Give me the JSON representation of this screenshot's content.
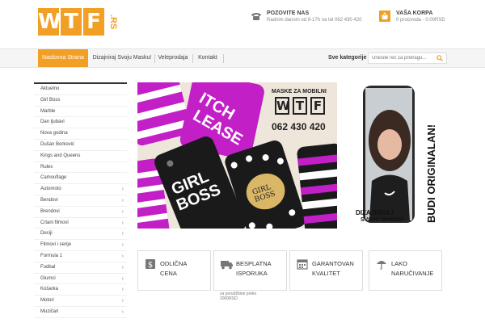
{
  "logo": {
    "letters": [
      "W",
      "T",
      "F"
    ],
    "suffix": ".RS"
  },
  "contact": {
    "title": "POZOVITE NAS",
    "subtitle": "Radnim danom od 9-17h na tel 062 430 420"
  },
  "cart": {
    "title": "VAŠA KORPA",
    "summary": "0 proizvoda  -  0.00RSD"
  },
  "nav": {
    "items": [
      {
        "label": "Naslovna Strana",
        "active": true
      },
      {
        "label": "Dizajniraj Svoju Masku!",
        "active": false
      },
      {
        "label": "Veleprodaja",
        "active": false
      },
      {
        "label": "Kontakt",
        "active": false
      }
    ],
    "categories_label": "Sve kategorije",
    "search_placeholder": "Unesite reč za pretragu..."
  },
  "sidebar": {
    "items": [
      {
        "label": "Aktuelno",
        "has_children": false
      },
      {
        "label": "Girl Boss",
        "has_children": false
      },
      {
        "label": "Marble",
        "has_children": false
      },
      {
        "label": "Dan ljubavi",
        "has_children": false
      },
      {
        "label": "Nova godina",
        "has_children": false
      },
      {
        "label": "Dušan Borković",
        "has_children": false
      },
      {
        "label": "Kings and Queens",
        "has_children": false
      },
      {
        "label": "Rules",
        "has_children": false
      },
      {
        "label": "Camouflage",
        "has_children": false
      },
      {
        "label": "Automoto",
        "has_children": true
      },
      {
        "label": "Bendovi",
        "has_children": true
      },
      {
        "label": "Brendovi",
        "has_children": true
      },
      {
        "label": "Crtani filmovi",
        "has_children": true
      },
      {
        "label": "Deciji",
        "has_children": true
      },
      {
        "label": "Filmovi i serije",
        "has_children": true
      },
      {
        "label": "Formula 1",
        "has_children": true
      },
      {
        "label": "Fudbal",
        "has_children": true
      },
      {
        "label": "Glumci",
        "has_children": true
      },
      {
        "label": "Košarka",
        "has_children": true
      },
      {
        "label": "Motori",
        "has_children": true
      },
      {
        "label": "Muzičari",
        "has_children": true
      }
    ]
  },
  "banner": {
    "title": "MASKE ZA MOBILNI",
    "logo_letters": [
      "W",
      "T",
      "F"
    ],
    "phone": "062 430 420",
    "case_texts": [
      "ITCH",
      "LEASE",
      "GIRL",
      "BOSS",
      "GIRL",
      "BOSS"
    ]
  },
  "ad": {
    "line1": "DIZAJNIRAJ",
    "line2": "SVOJU MASKU!",
    "vertical": "BUDI ORIGINALAN!"
  },
  "features": [
    {
      "icon": "money-bag-icon",
      "line1": "ODLIČNA",
      "line2": "CENA"
    },
    {
      "icon": "delivery-truck-icon",
      "line1": "BESPLATNA",
      "line2": "ISPORUKA",
      "note": "za porudžbine preko 2000RSD"
    },
    {
      "icon": "calendar-icon",
      "line1": "GARANTOVAN",
      "line2": "KVALITET"
    },
    {
      "icon": "umbrella-icon",
      "line1": "LAKO",
      "line2": "NARUČIVANJE"
    }
  ],
  "colors": {
    "accent": "#f29f26",
    "magenta": "#c21fc7",
    "dark": "#1a1a1a"
  }
}
